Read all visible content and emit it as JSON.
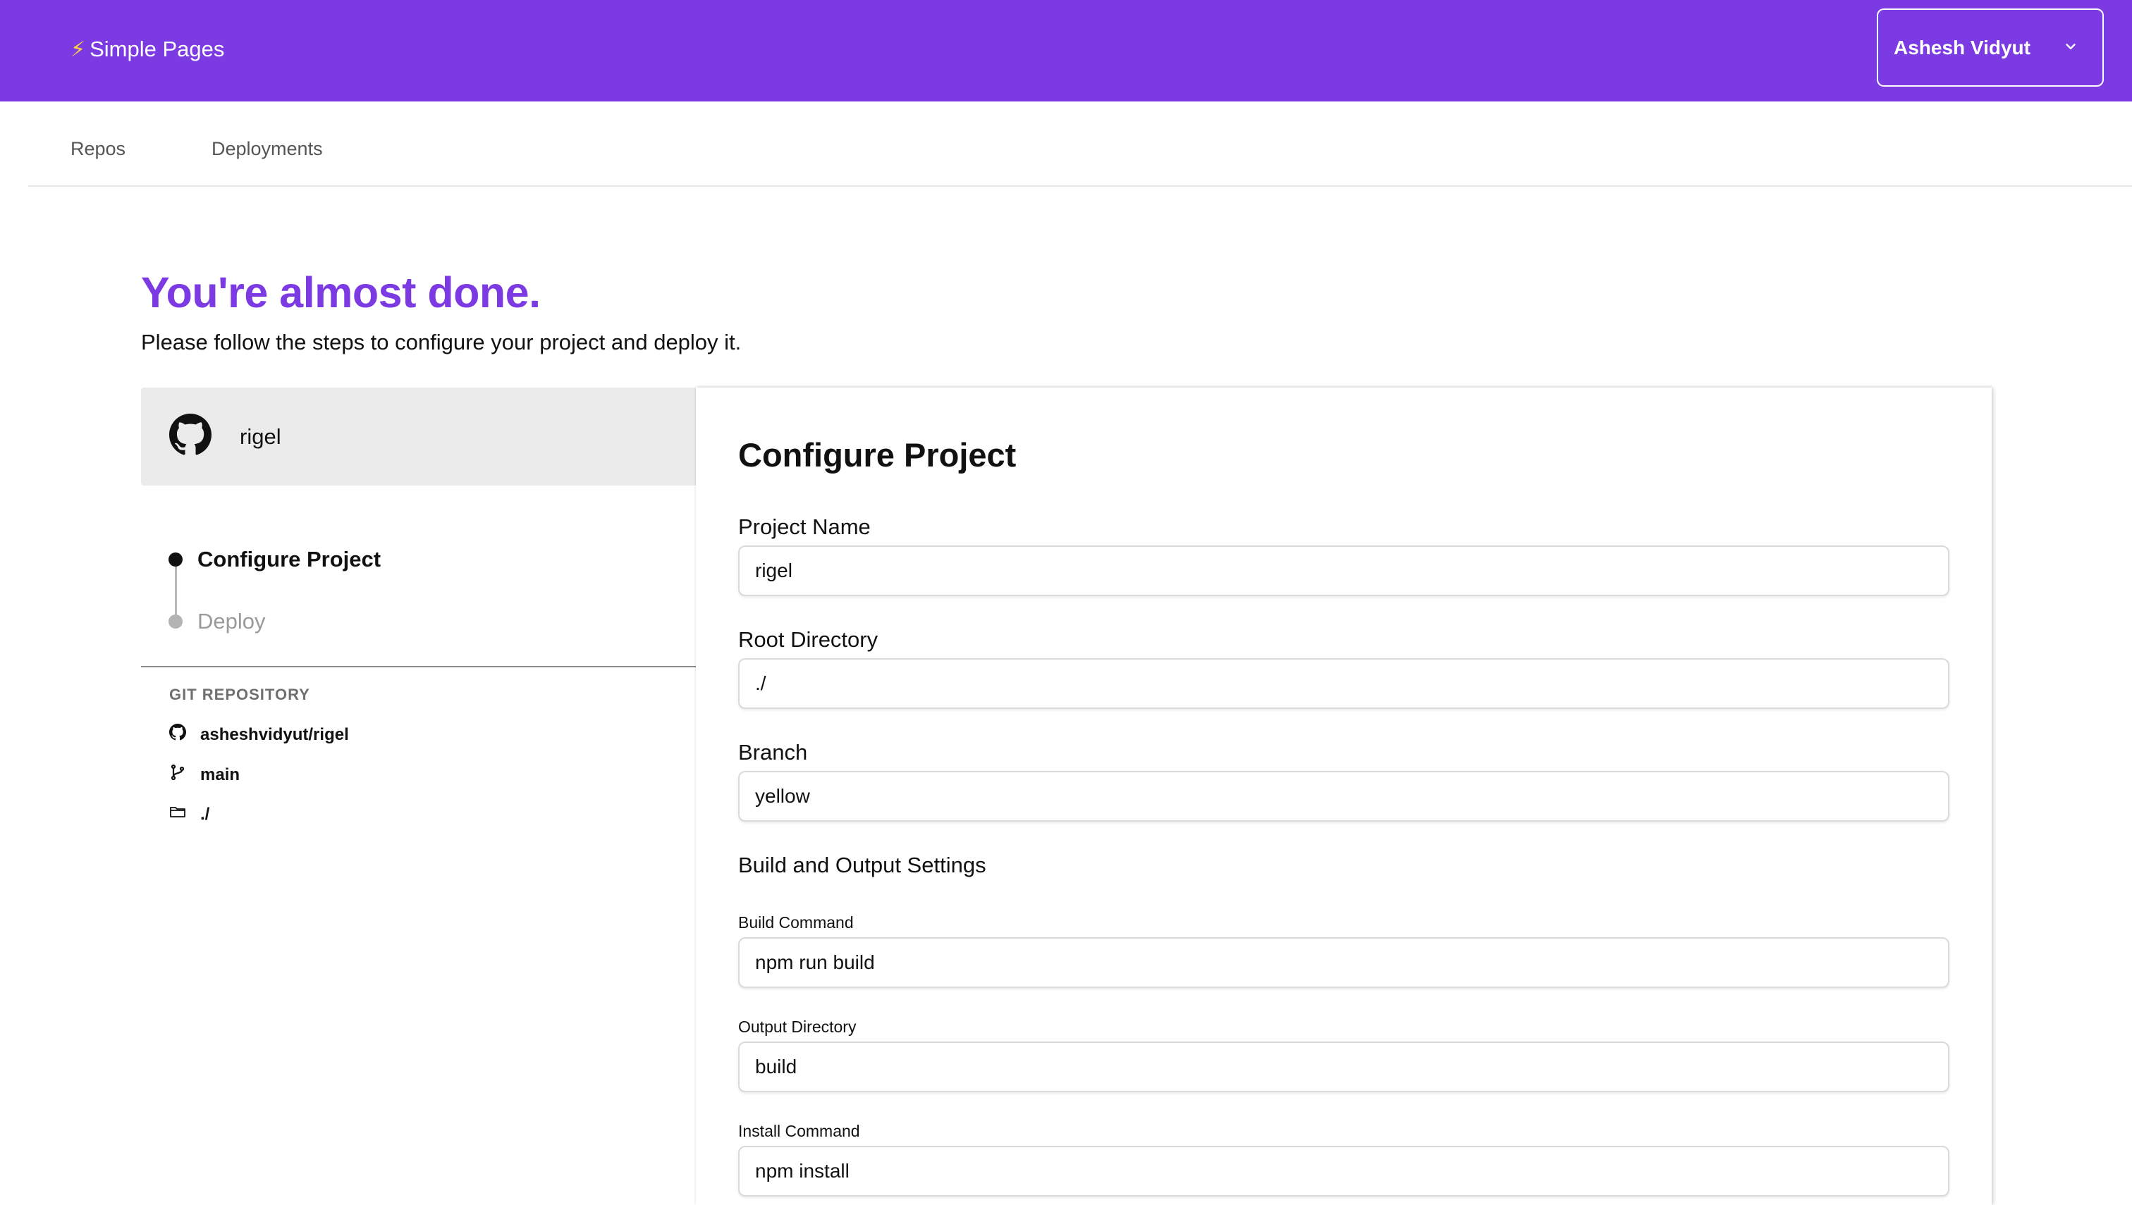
{
  "app": {
    "brand_icon": "⚡",
    "brand_name": "Simple Pages"
  },
  "user_menu": {
    "name": "Ashesh Vidyut",
    "icon": "chevron-down-icon"
  },
  "nav": {
    "tabs": [
      {
        "label": "Repos"
      },
      {
        "label": "Deployments"
      }
    ]
  },
  "hero": {
    "title": "You're almost done.",
    "subtitle": "Please follow the steps to configure your project and deploy it."
  },
  "repo_card": {
    "icon": "github-icon",
    "name": "rigel"
  },
  "steps": [
    {
      "label": "Configure Project",
      "active": true
    },
    {
      "label": "Deploy",
      "active": false
    }
  ],
  "git": {
    "title": "GIT REPOSITORY",
    "repository": "asheshvidyut/rigel",
    "branch": "main",
    "directory": "./"
  },
  "form": {
    "title": "Configure Project",
    "project_name": {
      "label": "Project Name",
      "value": "rigel"
    },
    "root_directory": {
      "label": "Root Directory",
      "value": "./"
    },
    "branch": {
      "label": "Branch",
      "value": "yellow"
    },
    "build_section_title": "Build and Output Settings",
    "build_command": {
      "label": "Build Command",
      "value": "npm run build"
    },
    "output_directory": {
      "label": "Output Directory",
      "value": "build"
    },
    "install_command": {
      "label": "Install Command",
      "value": "npm install"
    }
  },
  "colors": {
    "accent": "#7c3ae3",
    "panel_gray": "#ebebeb"
  }
}
